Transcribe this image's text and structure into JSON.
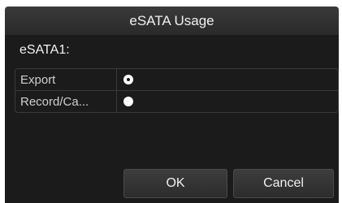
{
  "dialog": {
    "title": "eSATA Usage",
    "section_label": "eSATA1:",
    "options": [
      {
        "label": "Export",
        "selected": true
      },
      {
        "label": "Record/Ca...",
        "selected": false
      }
    ],
    "buttons": {
      "ok_label": "OK",
      "cancel_label": "Cancel"
    }
  },
  "colors": {
    "title_bg": "#2f2f2f",
    "body_bg": "#1b1b1b",
    "text": "#f0f0f0",
    "border": "#3a3a3a"
  }
}
